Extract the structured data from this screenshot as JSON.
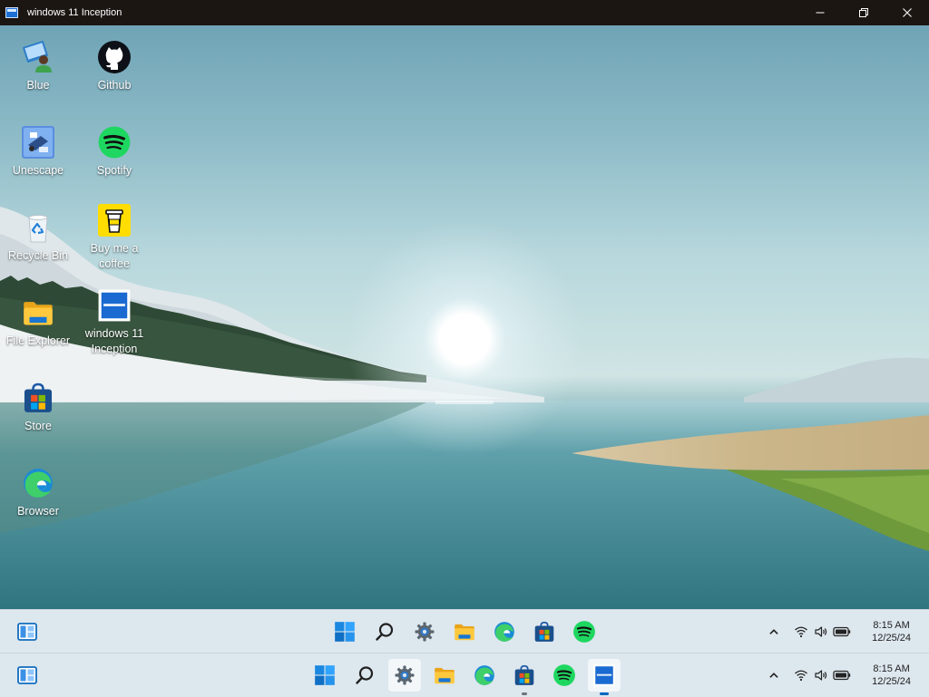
{
  "window": {
    "title": "windows 11 Inception",
    "controls": [
      "minimize",
      "restore",
      "close"
    ]
  },
  "desktop": {
    "icons": [
      {
        "label": "Blue",
        "icon": "blue-user-icon"
      },
      {
        "label": "Github",
        "icon": "github-icon"
      },
      {
        "label": "Unescape",
        "icon": "unescape-icon"
      },
      {
        "label": "Spotify",
        "icon": "spotify-icon"
      },
      {
        "label": "Recycle Bin",
        "icon": "recycle-bin-icon"
      },
      {
        "label": "Buy me a coffee",
        "icon": "coffee-icon"
      },
      {
        "label": "File Explorer",
        "icon": "folder-icon"
      },
      {
        "label": "windows 11 Inception",
        "icon": "inception-icon"
      },
      {
        "label": "Store",
        "icon": "store-icon"
      },
      {
        "label": "Browser",
        "icon": "edge-icon"
      }
    ]
  },
  "taskbar_inner": {
    "pinned": [
      "start-icon",
      "search-icon",
      "settings-icon",
      "folder-icon",
      "edge-icon",
      "store-icon",
      "spotify-icon"
    ],
    "time": "8:15 AM",
    "date": "12/25/24"
  },
  "taskbar_outer": {
    "pinned": [
      "start-icon",
      "search-icon",
      "settings-icon",
      "folder-icon",
      "edge-icon",
      "store-icon",
      "spotify-icon",
      "inception-icon"
    ],
    "time": "8:15 AM",
    "date": "12/25/24"
  },
  "colors": {
    "titlebar": "#1c1613",
    "taskbar": "#dde7ee",
    "accent": "#0067c0",
    "spotify": "#1ed760"
  }
}
